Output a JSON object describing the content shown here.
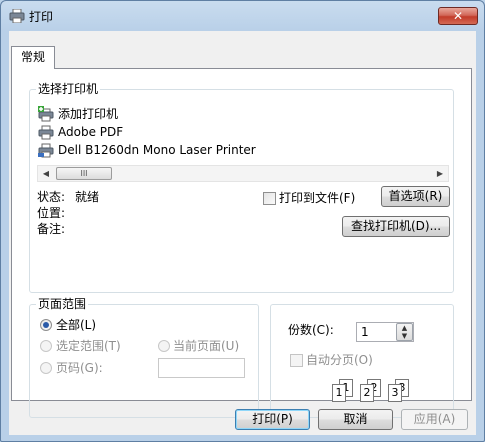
{
  "window": {
    "title": "打印",
    "close_label": "✕",
    "icon": "printer-icon"
  },
  "tabs": [
    {
      "label": "常规",
      "active": true
    }
  ],
  "select_printer": {
    "legend": "选择打印机",
    "printers": [
      {
        "label": "添加打印机",
        "icon": "add-printer-icon"
      },
      {
        "label": "Adobe PDF",
        "icon": "printer-icon"
      },
      {
        "label": "Dell B1260dn Mono Laser Printer",
        "icon": "network-printer-icon"
      }
    ],
    "scroll_left": "◀",
    "scroll_thumb": "III",
    "scroll_right": "▶",
    "status_label": "状态:",
    "status_value": "就绪",
    "location_label": "位置:",
    "comment_label": "备注:",
    "print_to_file_label": "打印到文件(F)",
    "preferences_button": "首选项(R)",
    "find_printer_button": "查找打印机(D)..."
  },
  "page_range": {
    "legend": "页面范围",
    "all_label": "全部(L)",
    "selection_label": "选定范围(T)",
    "current_page_label": "当前页面(U)",
    "pages_label": "页码(G):",
    "pages_value": ""
  },
  "copies": {
    "count_label": "份数(C):",
    "count_value": "1",
    "collate_label": "自动分页(O)",
    "collate_pages": [
      "1",
      "1",
      "2",
      "2",
      "3",
      "3"
    ]
  },
  "footer": {
    "print_button": "打印(P)",
    "cancel_button": "取消",
    "apply_button": "应用(A)"
  },
  "colors": {
    "title_bar": "#c9dcef",
    "close_button": "#c23b2a",
    "selected_radio": "#2a5aa8",
    "default_button_border": "#3c7fb1"
  }
}
